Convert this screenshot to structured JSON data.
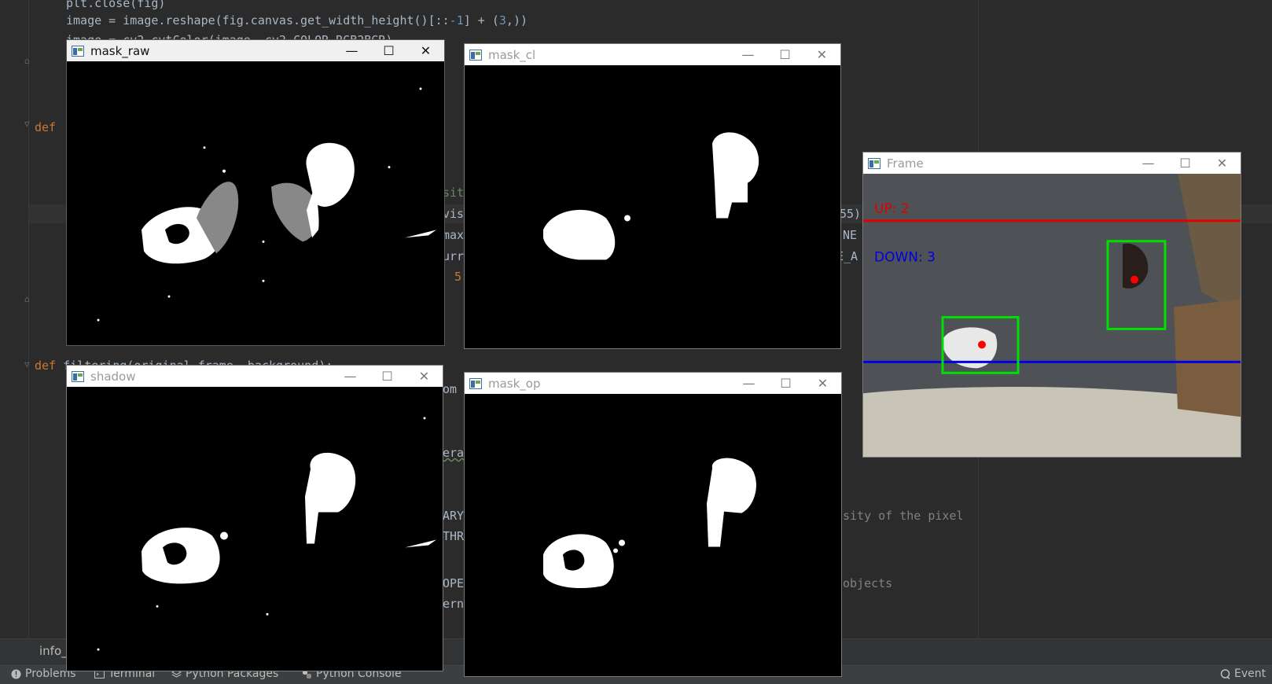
{
  "editor": {
    "code_lines": {
      "line1": "plt.close(fig)",
      "line2_a": "image = image.reshape(fig.canvas.get_width_height()[::",
      "line2_num": "-1",
      "line2_b": "] + (",
      "line2_num2": "3",
      "line2_c": ",))",
      "line3": "image = cv2.cvtColor(image, cv2.COLOR_RGB2BGR)",
      "def1": "def",
      "def2": "def",
      "def2_rest": " filtering(original_frame, background):"
    },
    "fragments": {
      "sit": "sit",
      "vis": "vis",
      "max": "max",
      "urr": "urr",
      "comma5": ", 5",
      "om": "om",
      "era": "era",
      "ary": "ARY",
      "thr": "THR",
      "ope": "OPE",
      "ern": "ern",
      "r55": "55)",
      "rne": "NE",
      "rea": "E_A",
      "comment1": "sity of the pixel",
      "comment2": "objects"
    },
    "bottom_tab": "info_"
  },
  "toolbar": {
    "problems": "Problems",
    "terminal": "Terminal",
    "python_packages": "Python Packages",
    "python_console": "Python Console",
    "event": "Event"
  },
  "windows": {
    "mask_raw": {
      "title": "mask_raw"
    },
    "mask_cl": {
      "title": "mask_cl"
    },
    "shadow": {
      "title": "shadow"
    },
    "mask_op": {
      "title": "mask_op"
    },
    "frame": {
      "title": "Frame",
      "up_label": "UP: 2",
      "down_label": "DOWN: 3",
      "up_line_color": "#e00000",
      "down_line_color": "#0000e0",
      "box_color": "#00e000"
    }
  },
  "window_controls": {
    "minimize": "—",
    "maximize": "☐",
    "close": "✕"
  }
}
